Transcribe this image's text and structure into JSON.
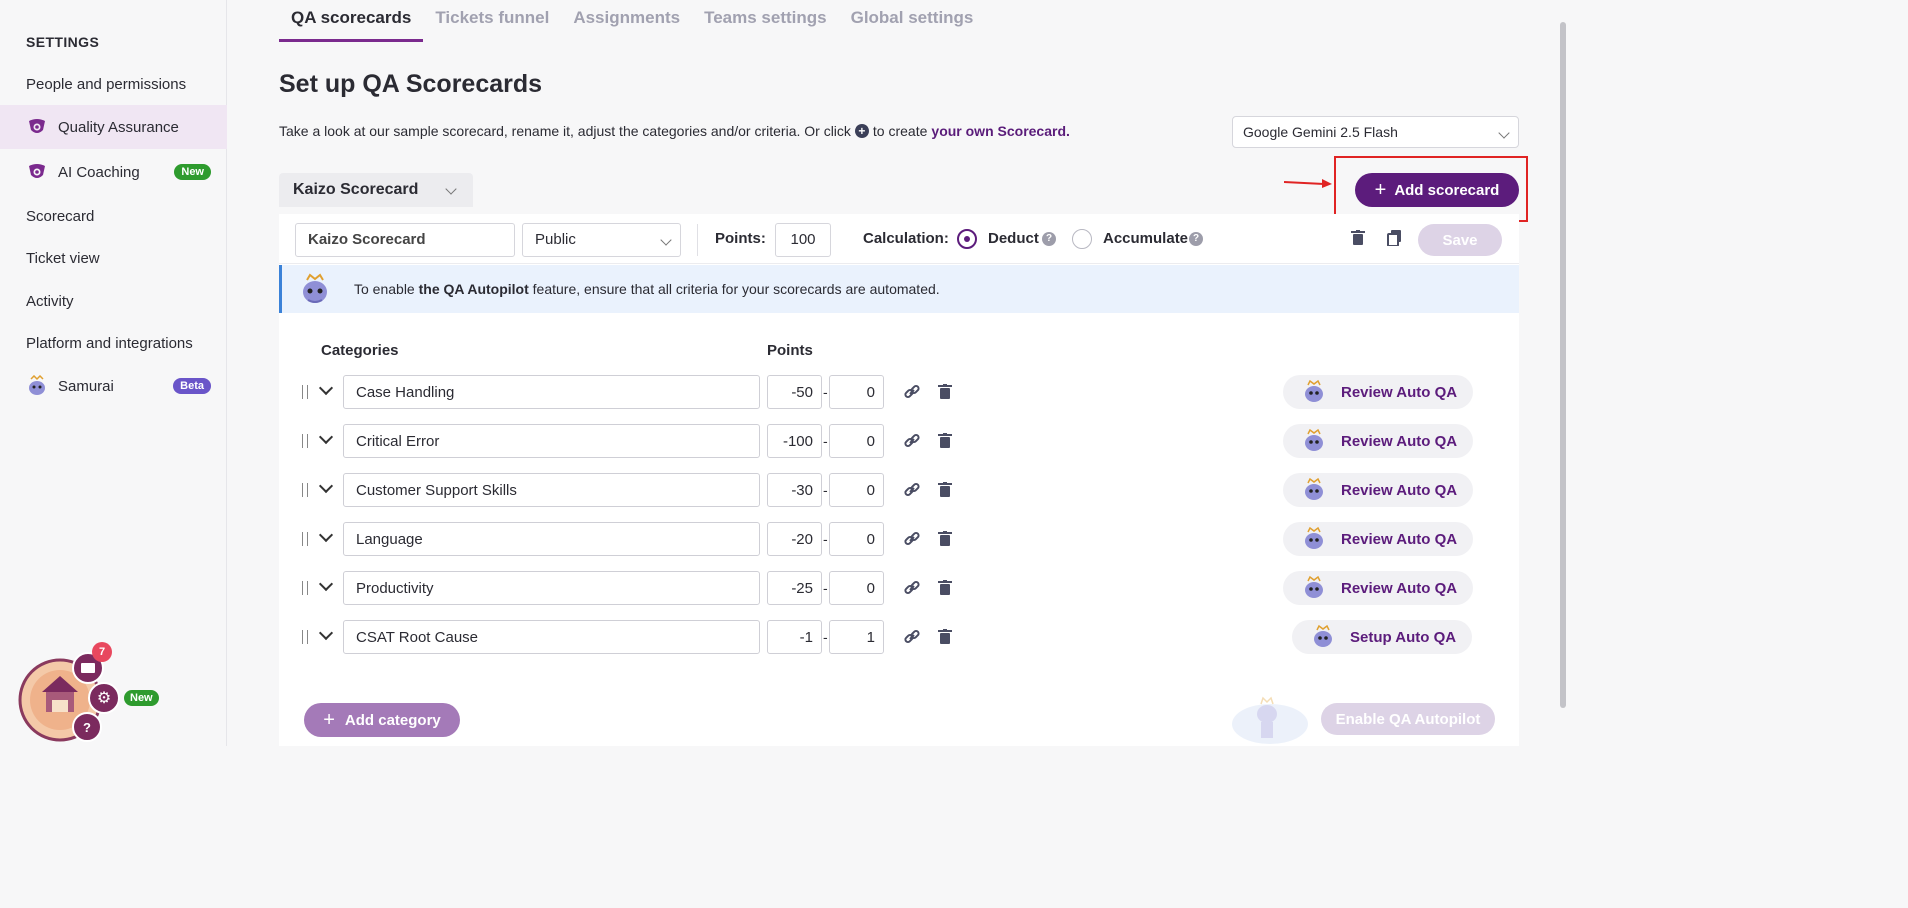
{
  "sidebar": {
    "heading": "SETTINGS",
    "items": [
      {
        "label": "People and permissions"
      },
      {
        "label": "Quality Assurance",
        "icon": "qa-brand-icon",
        "active": true
      },
      {
        "label": "AI Coaching",
        "icon": "qa-brand-icon",
        "badge": "New"
      },
      {
        "label": "Scorecard"
      },
      {
        "label": "Ticket view"
      },
      {
        "label": "Activity"
      },
      {
        "label": "Platform and integrations"
      },
      {
        "label": "Samurai",
        "icon": "samurai-bot-icon",
        "badge": "Beta"
      }
    ]
  },
  "tabs": [
    "QA scorecards",
    "Tickets funnel",
    "Assignments",
    "Teams settings",
    "Global settings"
  ],
  "page": {
    "title": "Set up QA Scorecards",
    "subtitle_pre": "Take a look at our sample scorecard, rename it, adjust the categories and/or criteria. Or click",
    "subtitle_mid": "to create",
    "subtitle_link": "your own Scorecard."
  },
  "model_select": {
    "value": "Google Gemini 2.5 Flash"
  },
  "scorecard_selector": {
    "value": "Kaizo Scorecard"
  },
  "add_scorecard_label": "Add scorecard",
  "toolbar": {
    "name_value": "Kaizo Scorecard",
    "visibility_value": "Public",
    "points_label": "Points:",
    "points_value": "100",
    "calculation_label": "Calculation:",
    "deduct_label": "Deduct",
    "accumulate_label": "Accumulate",
    "selected_calculation": "Deduct",
    "save_label": "Save"
  },
  "banner": {
    "pre": "To enable",
    "bold": "the QA Autopilot",
    "post": "feature, ensure that all criteria for your scorecards are automated."
  },
  "columns": {
    "categories": "Categories",
    "points": "Points"
  },
  "categories": [
    {
      "name": "Case Handling",
      "min": "-50",
      "max": "0",
      "action": "Review Auto QA"
    },
    {
      "name": "Critical Error",
      "min": "-100",
      "max": "0",
      "action": "Review Auto QA"
    },
    {
      "name": "Customer Support Skills",
      "min": "-30",
      "max": "0",
      "action": "Review Auto QA"
    },
    {
      "name": "Language",
      "min": "-20",
      "max": "0",
      "action": "Review Auto QA"
    },
    {
      "name": "Productivity",
      "min": "-25",
      "max": "0",
      "action": "Review Auto QA"
    },
    {
      "name": "CSAT Root Cause",
      "min": "-1",
      "max": "1",
      "action": "Setup Auto QA"
    }
  ],
  "add_category_label": "Add category",
  "enable_autopilot_label": "Enable QA Autopilot",
  "widget": {
    "mail_count": "7",
    "settings_badge": "New"
  },
  "colors": {
    "brand": "#5c1c7c",
    "highlight": "#e02424",
    "banner_bg": "#eaf2fd"
  }
}
